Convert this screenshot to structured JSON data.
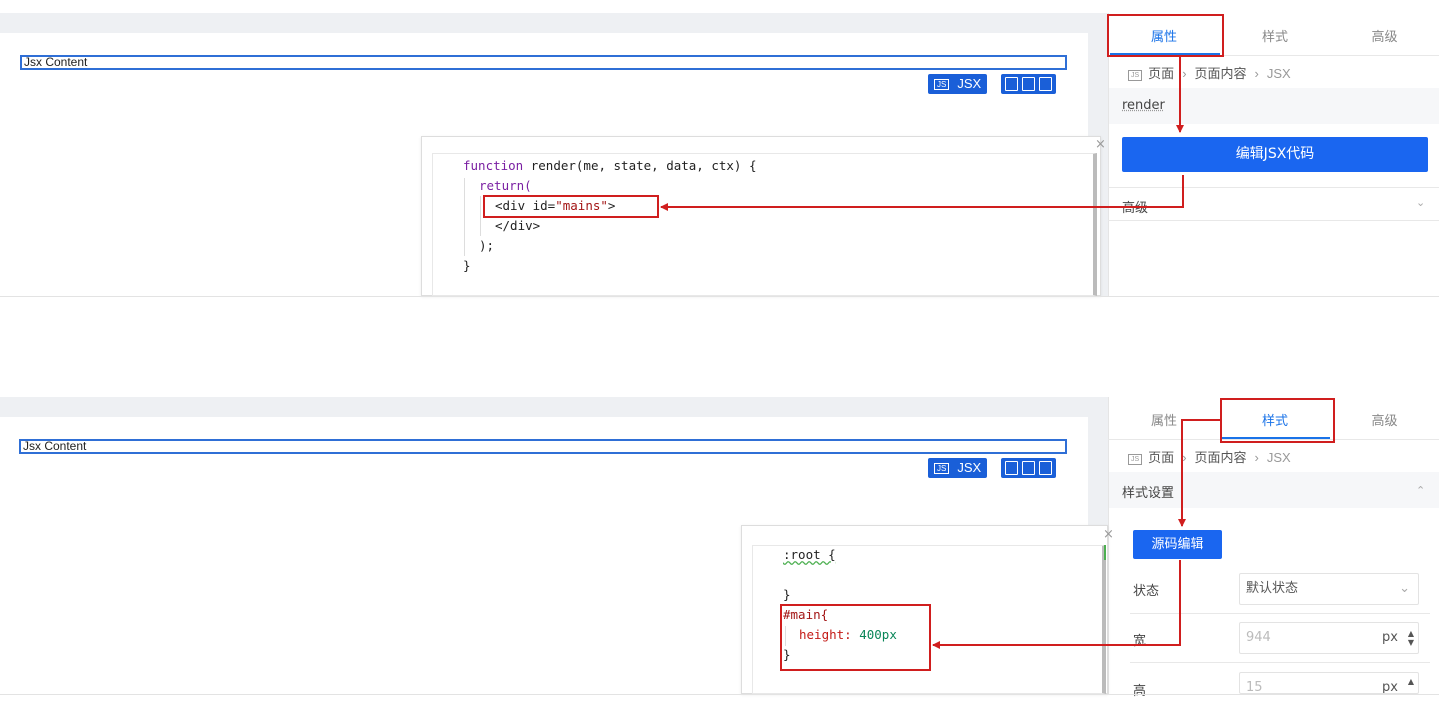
{
  "top": {
    "jsx_content_label": "Jsx Content",
    "toolbar": {
      "jsx_badge": "JS",
      "jsx_label": "JSX"
    },
    "tabs": [
      "属性",
      "样式",
      "高级"
    ],
    "active_tab": "属性",
    "breadcrumb": {
      "badge": "JS",
      "items": [
        "页面",
        "页面内容",
        "JSX"
      ]
    },
    "section_render": "render",
    "edit_button": "编辑JSX代码",
    "section_advanced": "高级",
    "code_lines": {
      "l1_kw": "function",
      "l1_rest": " render(me, state, data, ctx) {",
      "l2": "return(",
      "l3_a": "<div id=",
      "l3_str": "\"mains\"",
      "l3_b": ">",
      "l4": "</div>",
      "l5": ");",
      "l6": "}"
    },
    "close": "×"
  },
  "bottom": {
    "jsx_content_label": "Jsx Content",
    "toolbar": {
      "jsx_badge": "JS",
      "jsx_label": "JSX"
    },
    "tabs": [
      "属性",
      "样式",
      "高级"
    ],
    "active_tab": "样式",
    "breadcrumb": {
      "badge": "JS",
      "items": [
        "页面",
        "页面内容",
        "JSX"
      ]
    },
    "section_style": "样式设置",
    "source_edit_button": "源码编辑",
    "form": {
      "state_label": "状态",
      "state_value": "默认状态",
      "width_label": "宽",
      "width_value": "944",
      "width_unit": "px",
      "height_label": "高",
      "height_value": "15",
      "height_unit": "px"
    },
    "code_lines": {
      "l1": ":root {",
      "l2": "}",
      "l3": "#main{",
      "l4_prop": "height: ",
      "l4_val": "400px",
      "l5": "}"
    },
    "close": "×"
  },
  "colors": {
    "accent": "#1a73e8",
    "primary_button": "#1a66f0",
    "annotation": "#d01e1e",
    "jsx_border": "#2f6fd6"
  }
}
